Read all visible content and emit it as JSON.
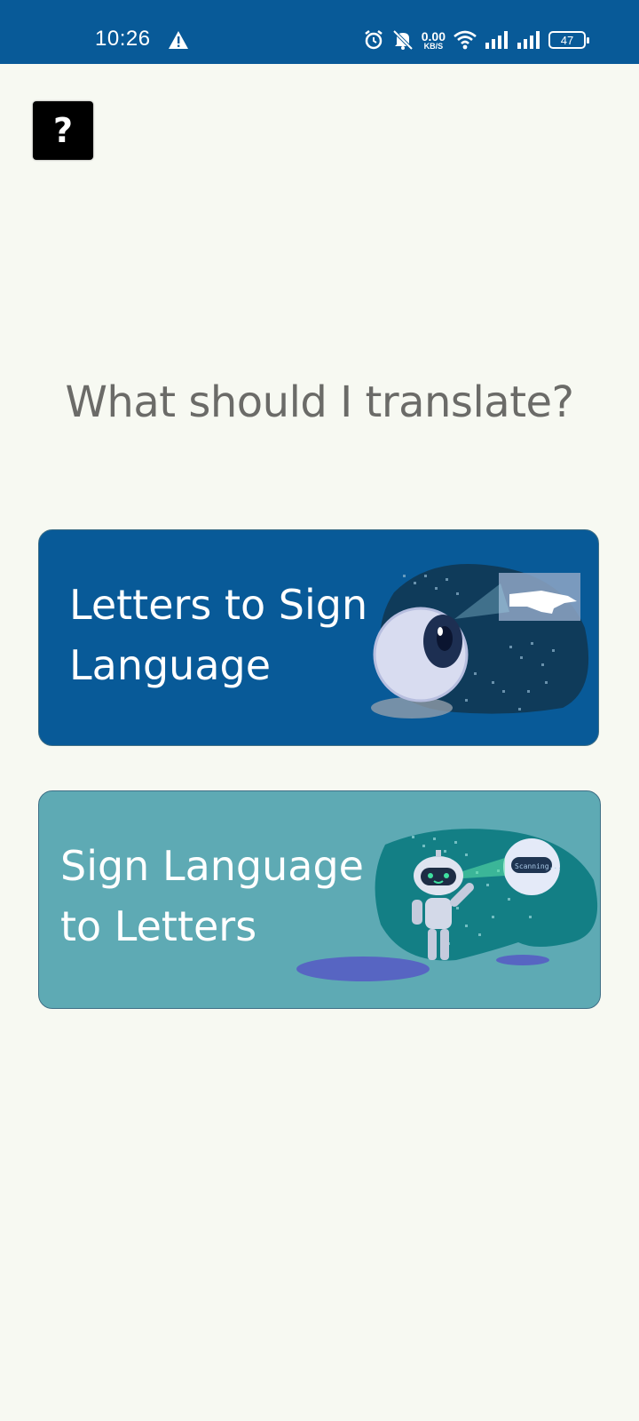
{
  "status_bar": {
    "time": "10:26",
    "net_speed_value": "0.00",
    "net_speed_unit": "KB/S",
    "battery_level": "47",
    "icons": [
      "warning-icon",
      "alarm-icon",
      "mute-icon",
      "wifi-icon",
      "signal-icon",
      "signal-icon",
      "battery-icon"
    ]
  },
  "help": {
    "label": "?"
  },
  "main": {
    "title": "What should I translate?",
    "options": [
      {
        "label": "Letters to Sign\nLanguage",
        "illustration": "eye-scanning-hand",
        "color": "#085a98"
      },
      {
        "label": "Sign Language\nto Letters",
        "illustration": "robot-scanning",
        "color": "#5eaab4"
      }
    ]
  }
}
